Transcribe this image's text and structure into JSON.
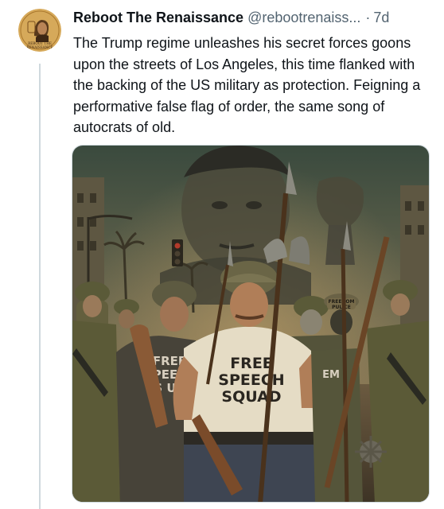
{
  "tweet": {
    "display_name": "Reboot The Renaissance",
    "handle": "@rebootrenaiss...",
    "separator": "·",
    "time": "7d",
    "text": "The Trump regime unleashes his secret forces goons upon the streets of Los Angeles, this time flanked with the backing of the US military as protection. Feigning a performative false flag of order, the same song of autocrats of old."
  },
  "avatar": {
    "logo_text_line1": "REBOOT THE",
    "logo_text_line2": "RENAISSANCE"
  },
  "image": {
    "main_shirt_line1": "FREE",
    "main_shirt_line2": "SPEECH",
    "main_shirt_line3": "SQUAD",
    "left_shirt_line1": "FREE",
    "left_shirt_line2": "PEEC",
    "left_shirt_line3": "S  UA",
    "right_shirt_fragment": "EM",
    "helmet_text_line1": "FREEDOM",
    "helmet_text_line2": "PULICE"
  },
  "colors": {
    "text_primary": "#0f1419",
    "text_secondary": "#536471",
    "thread_line": "#cfd9de",
    "avatar_bg": "#d6a95a"
  }
}
